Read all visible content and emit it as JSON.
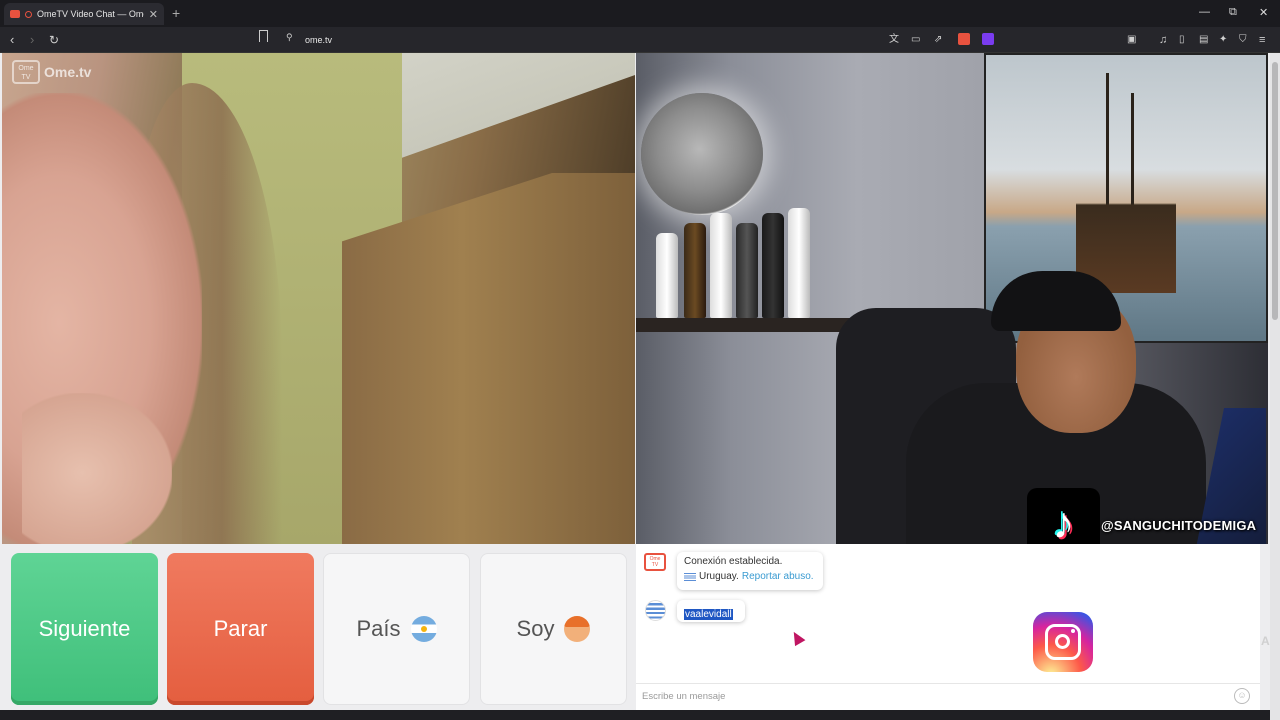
{
  "browser": {
    "tab_title": "OmeTV Video Chat — Omegl",
    "new_tab": "+",
    "url": "ome.tv",
    "window_controls": {
      "minimize": "—",
      "restore": "⧉",
      "close": "✕"
    }
  },
  "stranger_video": {
    "logo_box": "Ome TV",
    "logo_text": "Ome.tv"
  },
  "self_video": {
    "tiktok_handle": "@SANGUCHITODEMIGA"
  },
  "controls": {
    "next_label": "Siguiente",
    "stop_label": "Parar",
    "country_label": "País",
    "gender_label": "Soy"
  },
  "chat": {
    "system_icon": "Ome TV",
    "connection_text": "Conexión establecida.",
    "country_text": "Uruguay.",
    "report_link": "Reportar abuso.",
    "message": "vaalevidall",
    "input_placeholder": "Escribe un mensaje",
    "ghost_letter": "A"
  },
  "colors": {
    "next_green": "#3fbf7a",
    "stop_red": "#e45e3f",
    "report_blue": "#3a9bd1",
    "selection_blue": "#1f57c3"
  }
}
